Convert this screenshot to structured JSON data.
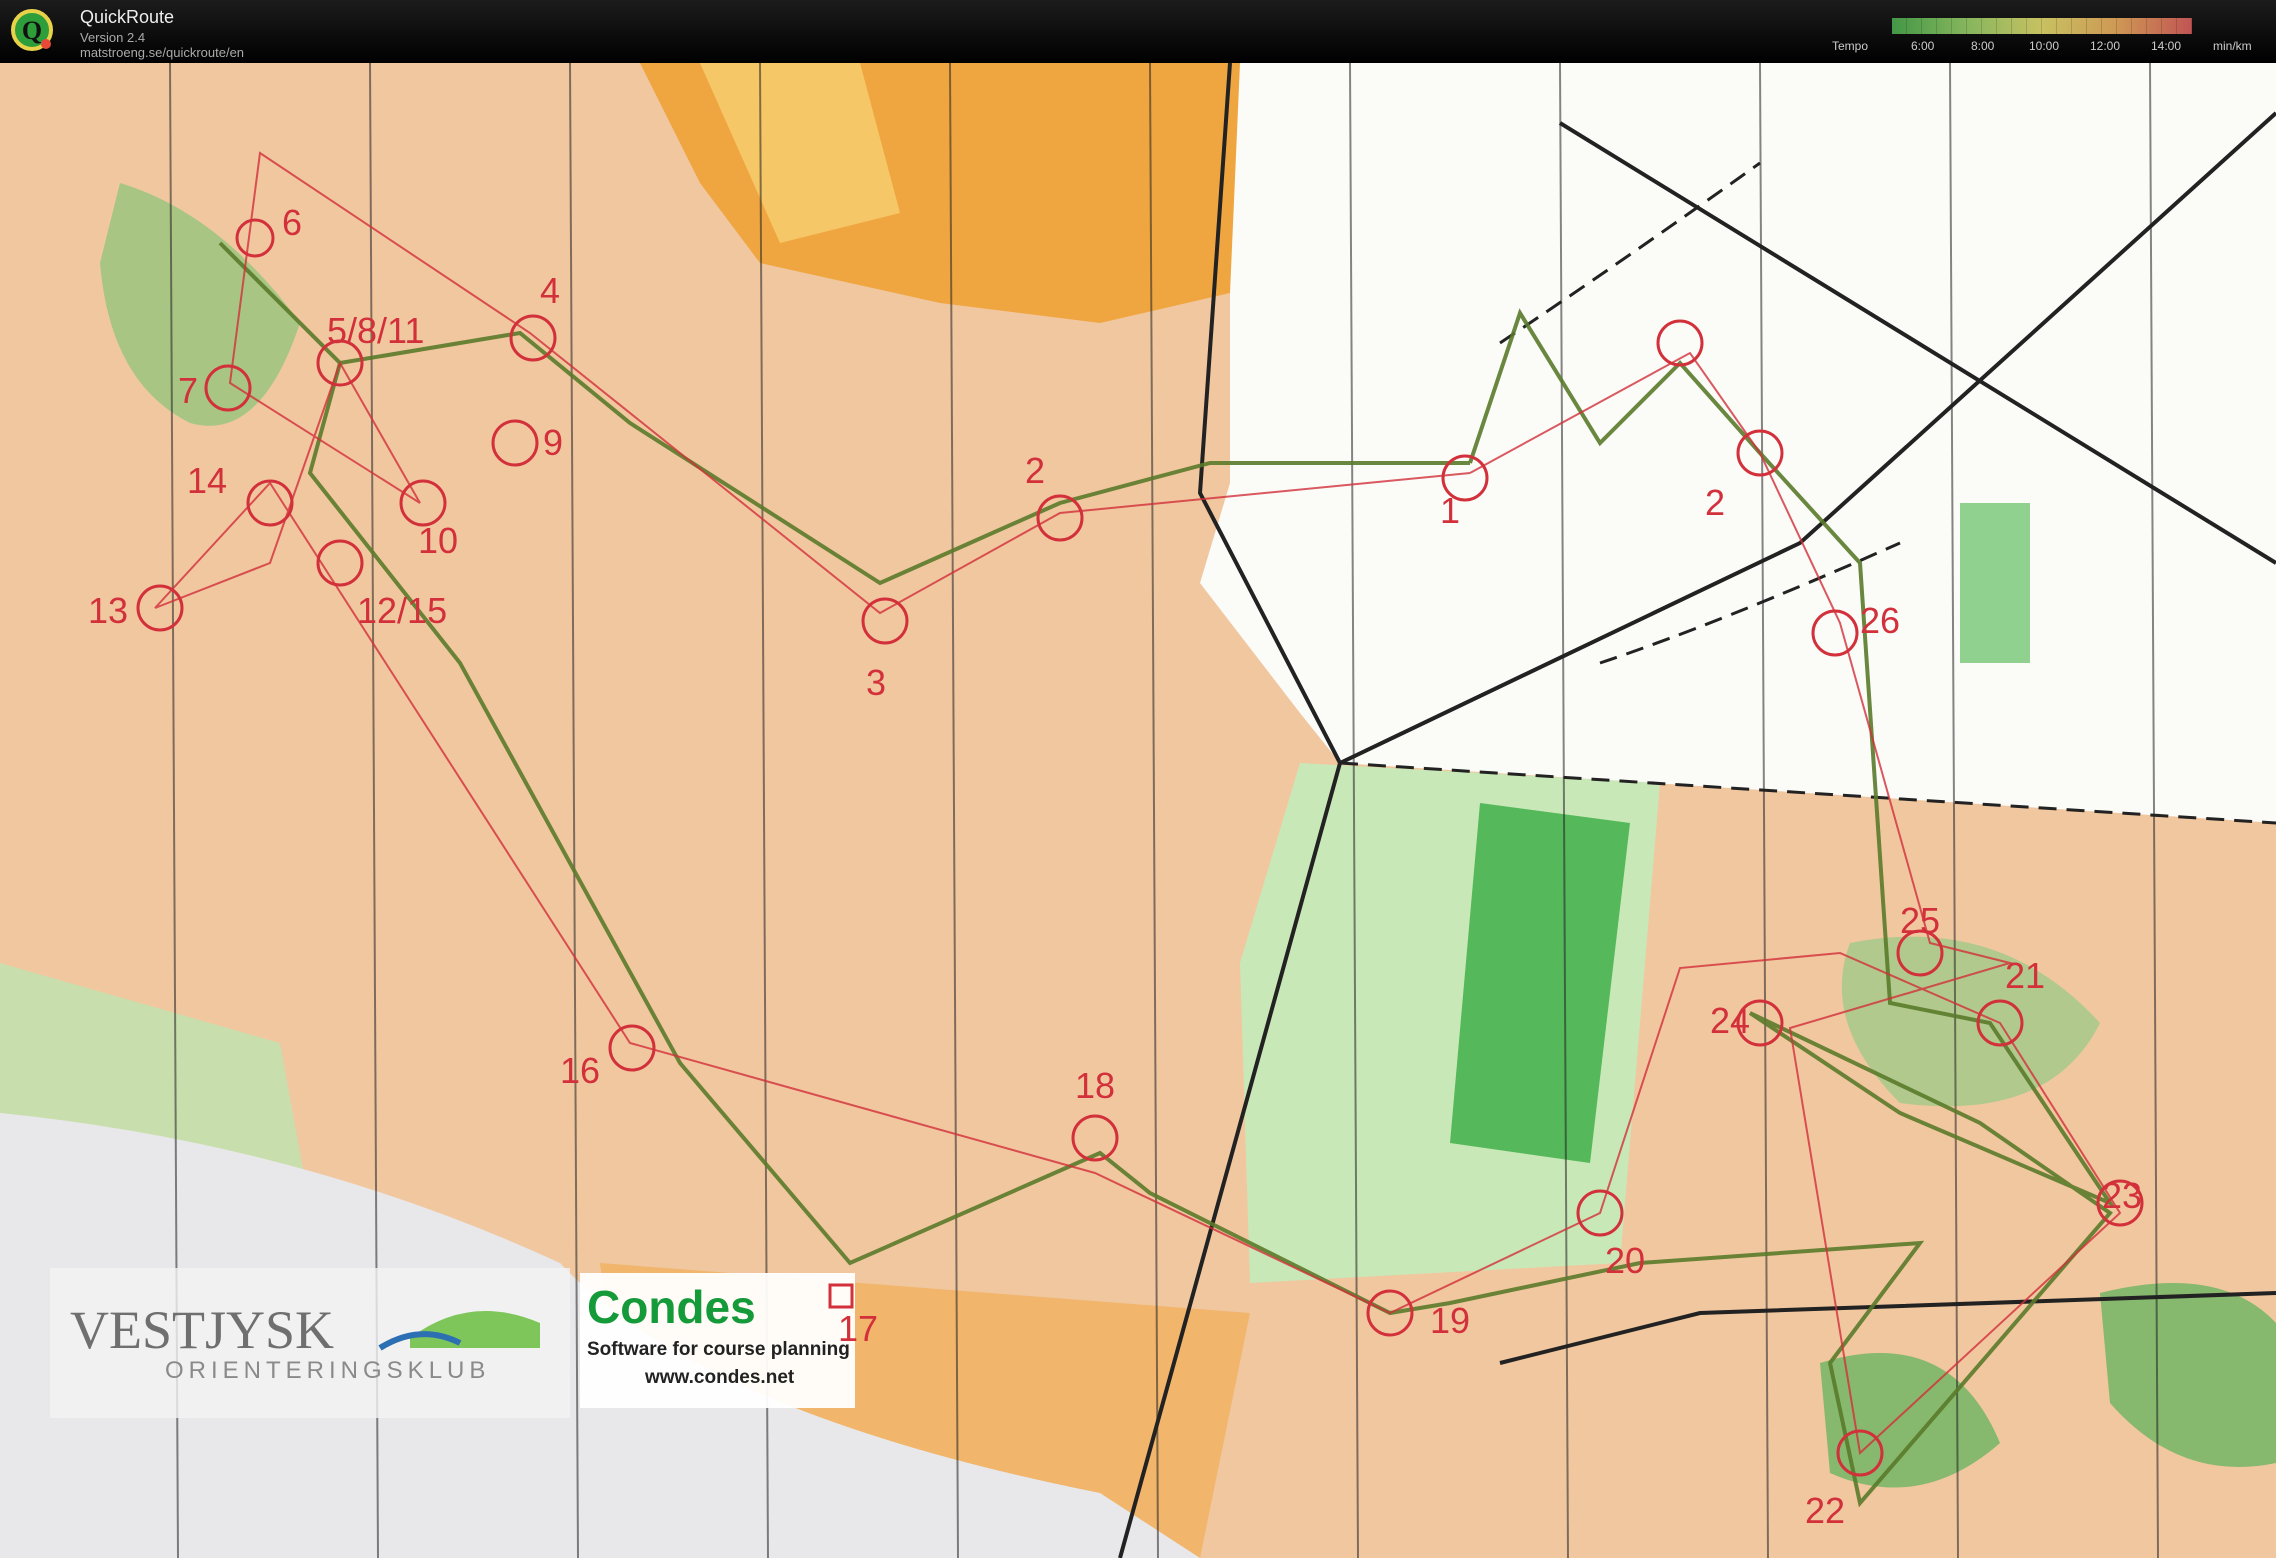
{
  "app": {
    "title": "QuickRoute",
    "version": "Version 2.4",
    "url": "matstroeng.se/quickroute/en"
  },
  "legend": {
    "label": "Tempo",
    "ticks": [
      "6:00",
      "8:00",
      "10:00",
      "12:00",
      "14:00"
    ],
    "unit": "min/km",
    "gradient_colors": [
      "#4caf50",
      "#9bd36a",
      "#e8e070",
      "#f0b060",
      "#e06060"
    ]
  },
  "map": {
    "colors": {
      "terrain": "#f3c9a3",
      "forest": "#3fae4c",
      "field": "#f0a640",
      "route": "#5a7a2a",
      "course": "#d2303a",
      "paper": "#e8e8ea"
    },
    "controls": [
      {
        "label": "1"
      },
      {
        "label": "2"
      },
      {
        "label": "2"
      },
      {
        "label": "3"
      },
      {
        "label": "4"
      },
      {
        "label": "5/8/11"
      },
      {
        "label": "6"
      },
      {
        "label": "7"
      },
      {
        "label": "9"
      },
      {
        "label": "10"
      },
      {
        "label": "12/15"
      },
      {
        "label": "13"
      },
      {
        "label": "14"
      },
      {
        "label": "16"
      },
      {
        "label": "18"
      },
      {
        "label": "19"
      },
      {
        "label": "20"
      },
      {
        "label": "21"
      },
      {
        "label": "22"
      },
      {
        "label": "23"
      },
      {
        "label": "24"
      },
      {
        "label": "25"
      },
      {
        "label": "26"
      }
    ],
    "sponsors": {
      "club_name": "VESTJYSK",
      "club_subtitle": "ORIENTERINGSKLUB",
      "condes_title": "Condes",
      "condes_tagline": "Software for course planning",
      "condes_url": "www.condes.net",
      "condes_control": "17"
    }
  }
}
